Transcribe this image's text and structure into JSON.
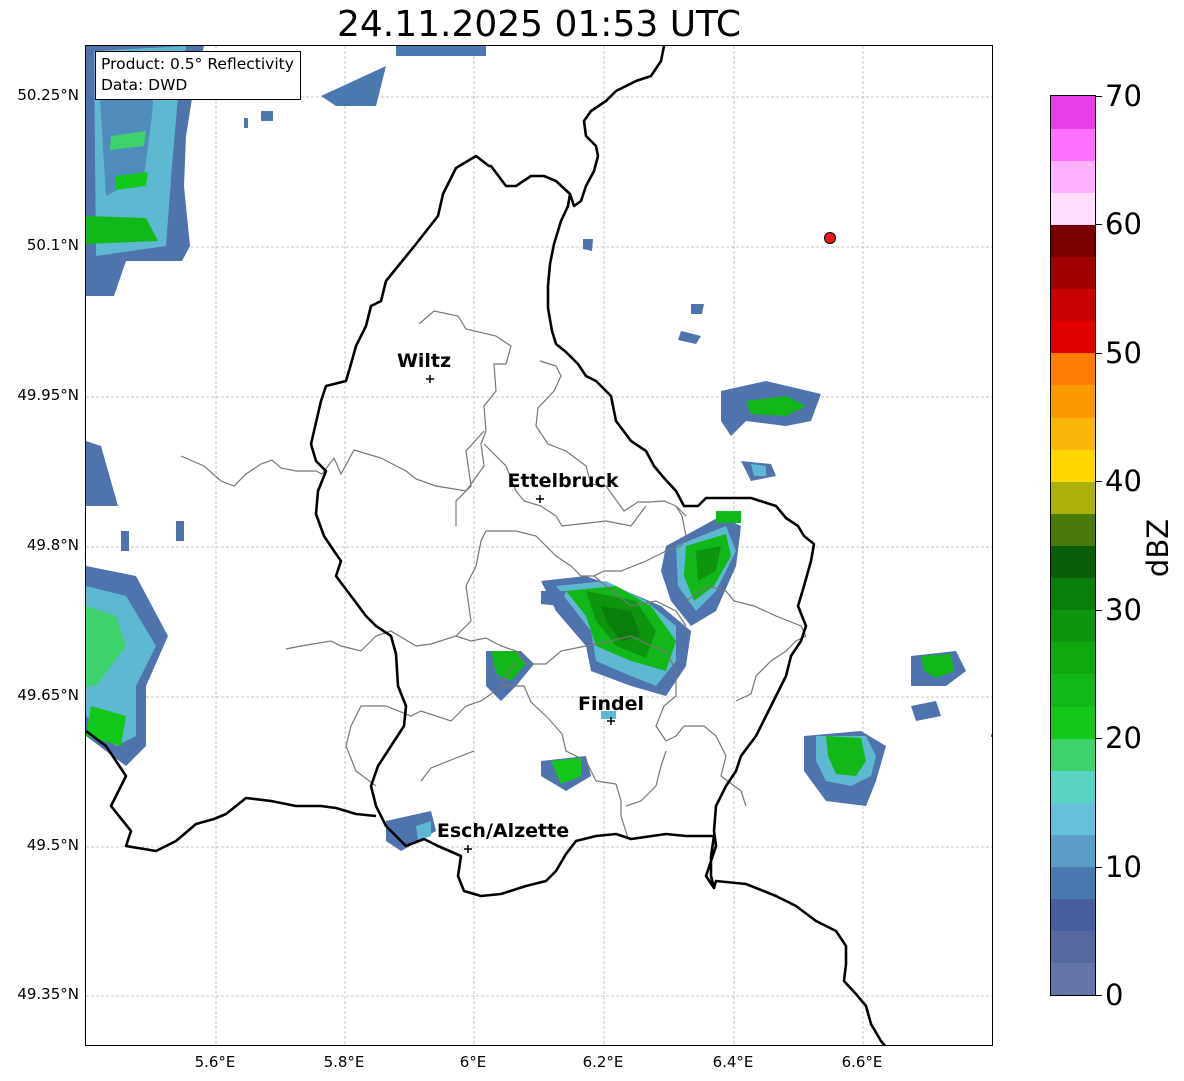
{
  "title": "24.11.2025 01:53 UTC",
  "info": {
    "line1": "Product: 0.5° Reflectivity",
    "line2": "Data: DWD"
  },
  "lat_ticks": [
    "50.25°N",
    "50.1°N",
    "49.95°N",
    "49.8°N",
    "49.65°N",
    "49.5°N",
    "49.35°N"
  ],
  "lon_ticks": [
    "5.6°E",
    "5.8°E",
    "6°E",
    "6.2°E",
    "6.4°E",
    "6.6°E"
  ],
  "cities": [
    {
      "name": "Wiltz"
    },
    {
      "name": "Ettelbruck"
    },
    {
      "name": "Findel"
    },
    {
      "name": "Esch/Alzette"
    }
  ],
  "colorbar": {
    "unit": "dBZ",
    "ticks": [
      "0",
      "10",
      "20",
      "30",
      "40",
      "50",
      "60",
      "70"
    ],
    "colors": [
      "#6374a6",
      "#55699e",
      "#485f9f",
      "#4a79b0",
      "#5c9dc7",
      "#66c0d9",
      "#5ad4c2",
      "#3dd26c",
      "#12c81a",
      "#12b81a",
      "#0fa80f",
      "#0d950d",
      "#0a7e0a",
      "#0a5e0a",
      "#4a7a0a",
      "#adb20a",
      "#ffd700",
      "#fbb60a",
      "#fa9a00",
      "#ff7d00",
      "#e10000",
      "#c80000",
      "#a00000",
      "#7a0000",
      "#ffddff",
      "#ffb0ff",
      "#ff70ff",
      "#e83ee8"
    ]
  },
  "marker": {
    "color": "#e41a1c"
  },
  "layers": {
    "basemap": "radar-reflectivity-map",
    "national_border_color": "#000000",
    "canton_border_color": "#777777"
  }
}
